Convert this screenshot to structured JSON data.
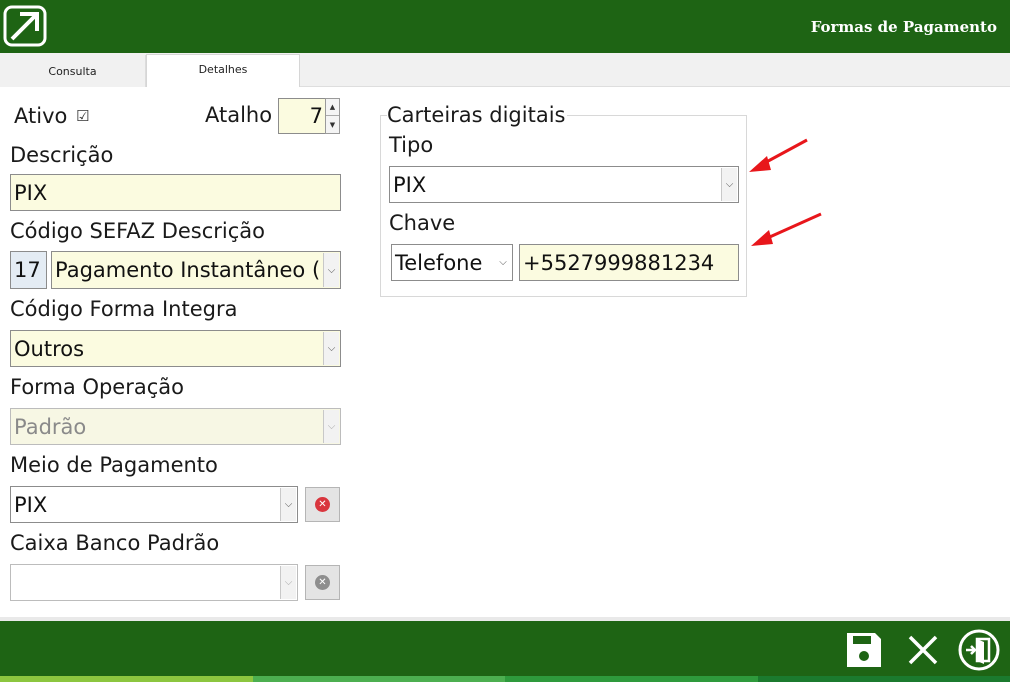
{
  "header": {
    "title": "Formas de Pagamento",
    "logo_icon": "arrow-up-right-logo"
  },
  "tabs": [
    {
      "label": "Consulta"
    },
    {
      "label": "Detalhes"
    }
  ],
  "form": {
    "ativo_label": "Ativo",
    "ativo_checked": true,
    "atalho_label": "Atalho",
    "atalho_value": "7",
    "descricao_label": "Descrição",
    "descricao_value": "PIX",
    "sefaz_label": "Código SEFAZ Descrição",
    "sefaz_code": "17",
    "sefaz_desc": "Pagamento Instantâneo (",
    "integra_label": "Código Forma Integra",
    "integra_value": "Outros",
    "operacao_label": "Forma Operação",
    "operacao_value": "Padrão",
    "meio_label": "Meio de Pagamento",
    "meio_value": "PIX",
    "caixa_label": "Caixa Banco Padrão",
    "caixa_value": ""
  },
  "carteiras": {
    "title": "Carteiras digitais",
    "tipo_label": "Tipo",
    "tipo_value": "PIX",
    "chave_label": "Chave",
    "chave_tipo": "Telefone",
    "chave_value": "+5527999881234"
  },
  "colors": {
    "brand_green": "#1e6414",
    "field_bg": "#fbfbe0",
    "annotation_arrow": "#e8161b",
    "strip": [
      "#8cc63f",
      "#4caf50",
      "#2e9a3c",
      "#1b7a2e"
    ]
  },
  "footer": {
    "icons": [
      "save-icon",
      "close-icon",
      "exit-icon"
    ]
  }
}
